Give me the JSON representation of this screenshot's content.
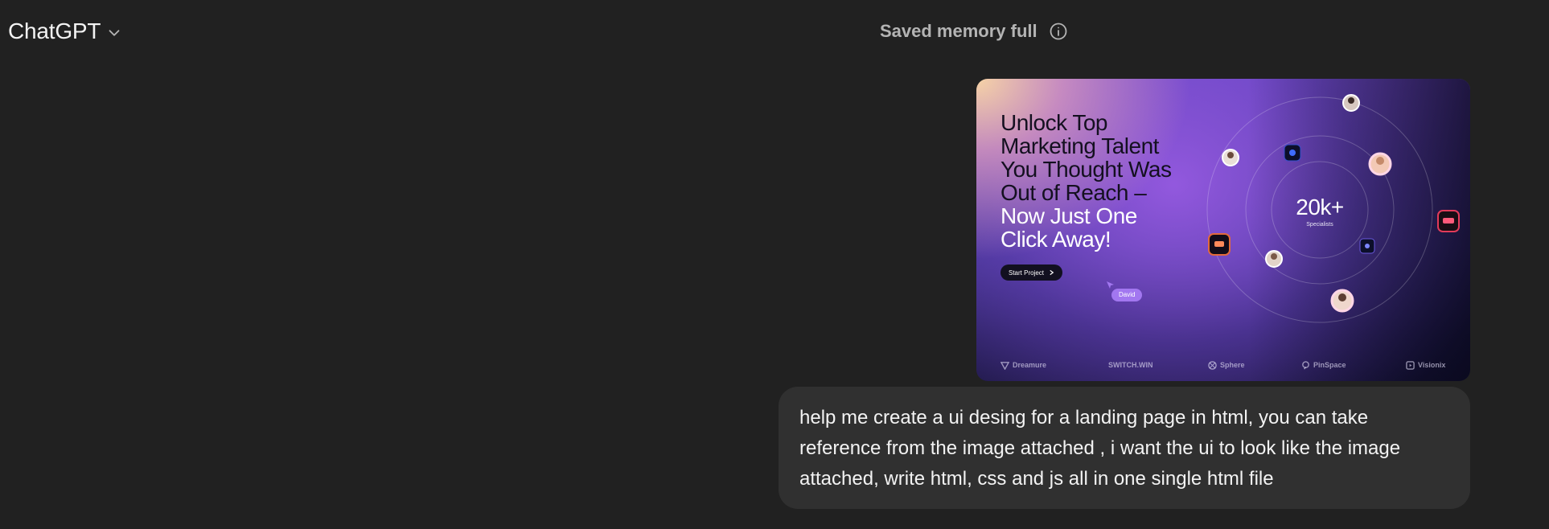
{
  "header": {
    "model_name": "ChatGPT",
    "memory_status": "Saved memory full"
  },
  "attachment": {
    "headline_lines": [
      "Unlock Top",
      "Marketing Talent",
      "You Thought Was",
      "Out of Reach –",
      "Now Just One",
      "Click Away!"
    ],
    "cta_label": "Start Project",
    "cursor_tag": "David",
    "stat_value": "20k+",
    "stat_label": "Specialists",
    "logos": [
      "Dreamure",
      "SWITCH.WIN",
      "Sphere",
      "PinSpace",
      "Visionix"
    ]
  },
  "message": {
    "text": "help me create a ui desing for a landing page in html, you can take reference from the image attached , i want the ui to look like the image attached, write html, css and js all in one single html file"
  },
  "icons": {
    "model_dropdown": "chevron-down-icon",
    "memory_info": "info-icon"
  },
  "colors": {
    "background": "#212121",
    "bubble": "#303030",
    "accent_purple": "#a277f0"
  }
}
